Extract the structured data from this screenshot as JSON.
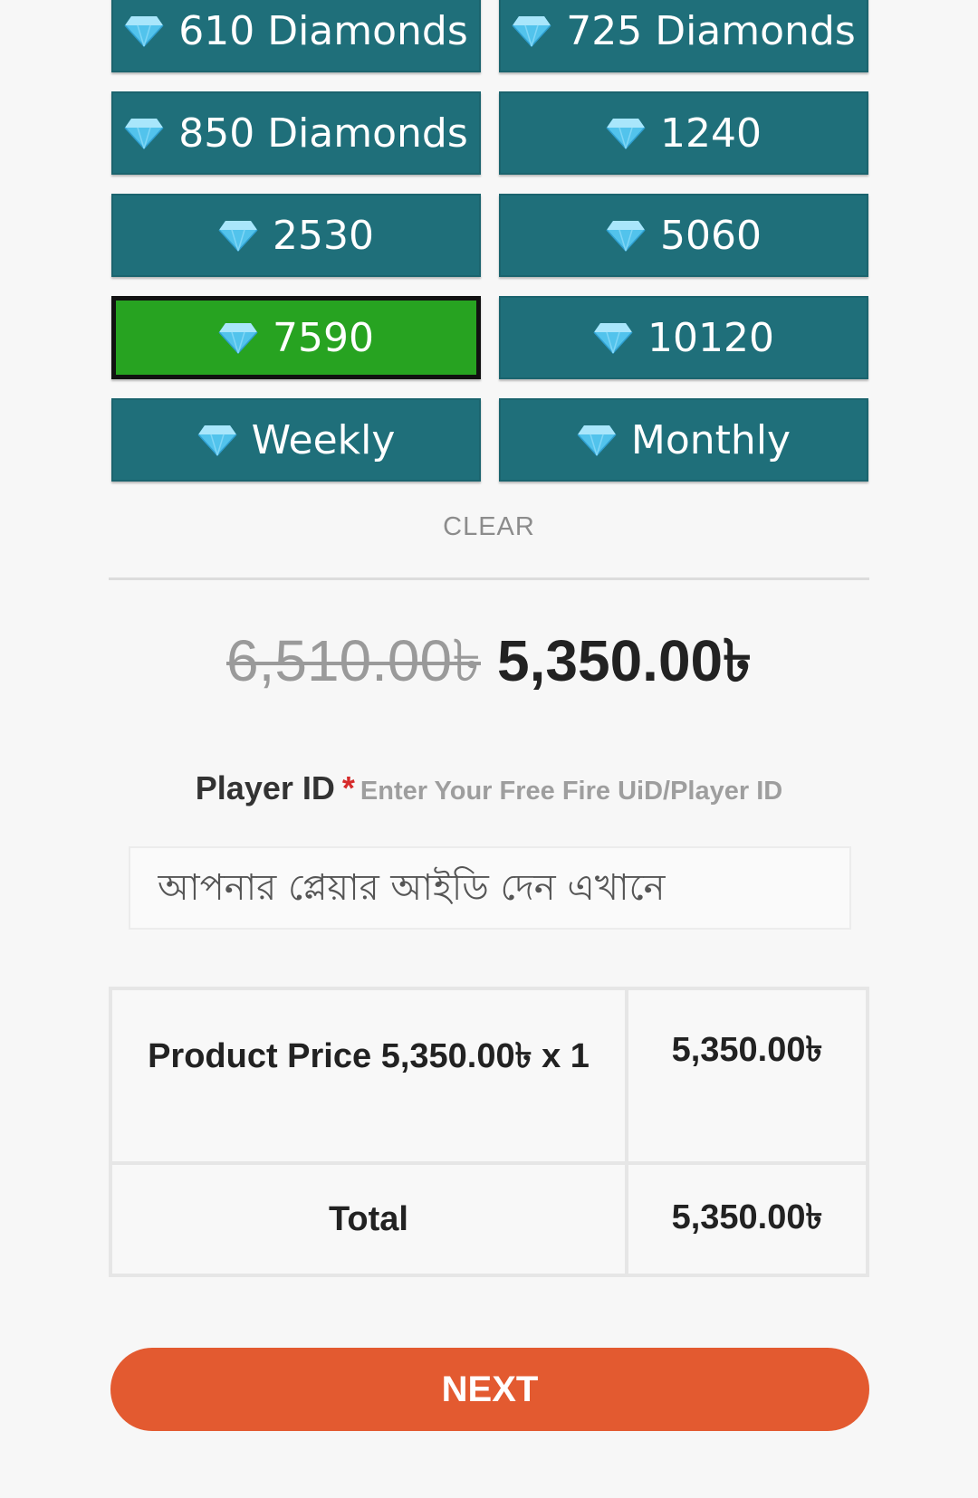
{
  "colors": {
    "option_bg": "#1f6f7a",
    "option_selected_bg": "#27a321",
    "next_button_bg": "#e35a30"
  },
  "options": [
    {
      "label": "610 Diamonds",
      "icon": "diamond-icon"
    },
    {
      "label": "725 Diamonds",
      "icon": "diamond-icon"
    },
    {
      "label": "850 Diamonds",
      "icon": "diamond-icon"
    },
    {
      "label": "1240",
      "icon": "diamond-icon"
    },
    {
      "label": "2530",
      "icon": "diamond-icon"
    },
    {
      "label": "5060",
      "icon": "diamond-icon"
    },
    {
      "label": "7590",
      "icon": "diamond-icon",
      "selected": true
    },
    {
      "label": "10120",
      "icon": "diamond-icon"
    },
    {
      "label": "Weekly",
      "icon": "diamond-icon"
    },
    {
      "label": "Monthly",
      "icon": "diamond-icon"
    }
  ],
  "clear_label": "CLEAR",
  "price": {
    "old": "6,510.00৳",
    "new": "5,350.00৳"
  },
  "player_id": {
    "label": "Player ID",
    "required_mark": "*",
    "hint": "Enter Your Free Fire UiD/Player ID",
    "placeholder": "আপনার প্লেয়ার আইডি দেন এখানে",
    "value": ""
  },
  "summary": {
    "product_label": "Product Price 5,350.00৳ x 1",
    "product_amount": "5,350.00৳",
    "total_label": "Total",
    "total_amount": "5,350.00৳"
  },
  "next_label": "NEXT"
}
